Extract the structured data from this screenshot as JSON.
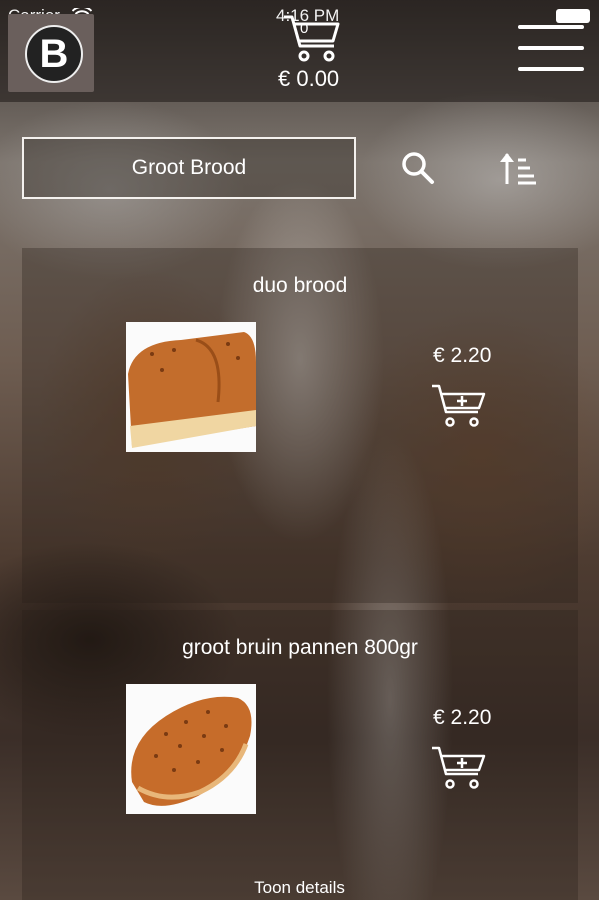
{
  "status": {
    "carrier": "Carrier",
    "time": "4:16 PM"
  },
  "header": {
    "logo_letter": "B",
    "cart_count": "0",
    "cart_total": "€ 0.00"
  },
  "search": {
    "value": "Groot Brood"
  },
  "products": [
    {
      "name": "duo brood",
      "price": "€ 2.20"
    },
    {
      "name": "groot bruin pannen 800gr",
      "price": "€ 2.20"
    }
  ],
  "footer": {
    "details_label": "Toon details"
  },
  "colors": {
    "text": "#ffffff",
    "overlay": "#2a201a"
  }
}
